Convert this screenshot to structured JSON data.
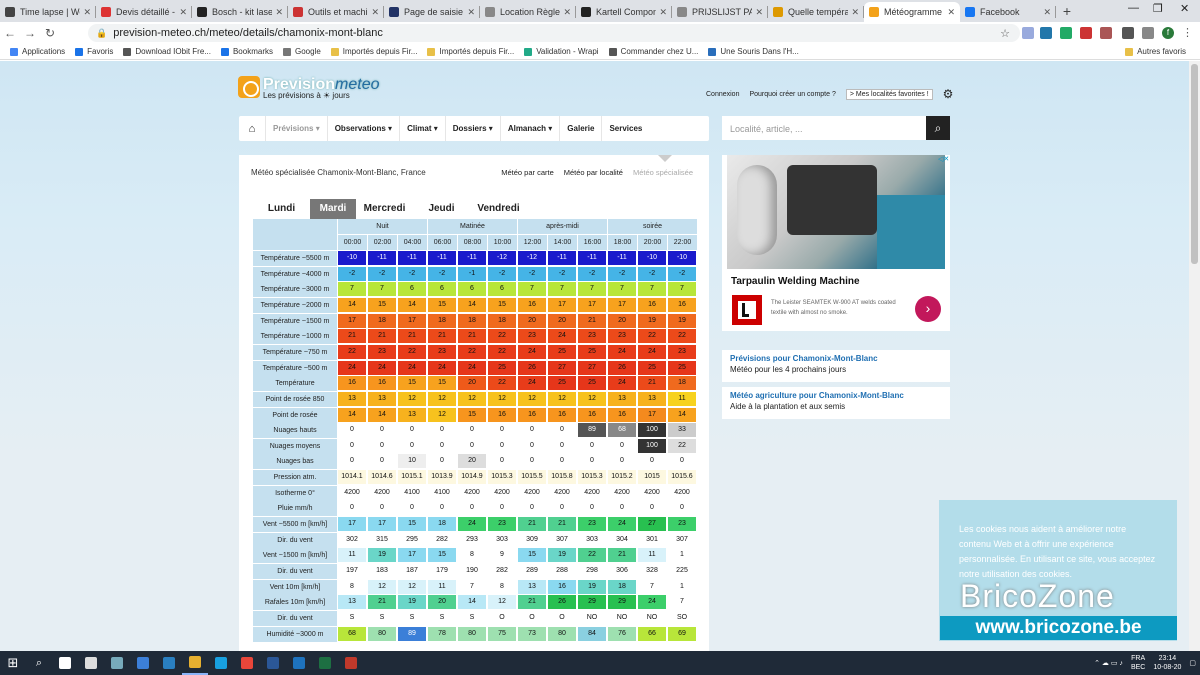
{
  "browser": {
    "tabs": [
      {
        "title": "Time lapse | Wei",
        "color": "#444"
      },
      {
        "title": "Devis détaillé - E",
        "color": "#d33"
      },
      {
        "title": "Bosch - kit laser",
        "color": "#222"
      },
      {
        "title": "Outils et machin",
        "color": "#c33"
      },
      {
        "title": "Page de saisie de",
        "color": "#236"
      },
      {
        "title": "Location Règle à",
        "color": "#888"
      },
      {
        "title": "Kartell Compone",
        "color": "#222"
      },
      {
        "title": "PRIJSLIJST PARTI",
        "color": "#888"
      },
      {
        "title": "Quelle températu",
        "color": "#d90"
      },
      {
        "title": "Météogramme d",
        "color": "#f3a21a"
      },
      {
        "title": "Facebook",
        "color": "#1877f2"
      }
    ],
    "url": "prevision-meteo.ch/meteo/details/chamonix-mont-blanc",
    "bookmarks": [
      {
        "label": "Applications",
        "color": "#4285f4"
      },
      {
        "label": "Favoris",
        "color": "#1a73e8"
      },
      {
        "label": "Download IObit Fre...",
        "color": "#555"
      },
      {
        "label": "Bookmarks",
        "color": "#1a73e8"
      },
      {
        "label": "Google",
        "color": "#777"
      },
      {
        "label": "Importés depuis Fir...",
        "color": "#e8c048"
      },
      {
        "label": "Importés depuis Fir...",
        "color": "#e8c048"
      },
      {
        "label": "Validation - Wrapi",
        "color": "#2a8"
      },
      {
        "label": "Commander chez U...",
        "color": "#555"
      },
      {
        "label": "Une Souris Dans l'H...",
        "color": "#2a6ebb"
      }
    ],
    "other_bookmarks": "Autres favoris",
    "profile": "f"
  },
  "site": {
    "logo_text": "Prevision",
    "logo_meteo": "meteo",
    "tagline": "Les prévisions à ☀ jours",
    "connexion": "Connexion",
    "create": "Pourquoi créer un compte ?",
    "fav": "> Mes localités favorites !",
    "nav": [
      "Prévisions ▾",
      "Observations ▾",
      "Climat ▾",
      "Dossiers ▾",
      "Almanach ▾",
      "Galerie",
      "Services"
    ],
    "search_placeholder": "Localité, article, ..."
  },
  "main": {
    "title": "Météo spécialisée Chamonix-Mont-Blanc, France",
    "tabs": [
      "Météo par carte",
      "Météo par localité",
      "Météo spécialisée"
    ],
    "days": [
      "Lundi",
      "Mardi",
      "Mercredi",
      "Jeudi",
      "Vendredi"
    ],
    "periods": [
      "Nuit",
      "Matinée",
      "après-midi",
      "soirée"
    ],
    "hours": [
      "00:00",
      "02:00",
      "04:00",
      "06:00",
      "08:00",
      "10:00",
      "12:00",
      "14:00",
      "16:00",
      "18:00",
      "20:00",
      "22:00"
    ],
    "rows": [
      {
        "label": "Température ~5500 m",
        "values": [
          "-10",
          "-11",
          "-11",
          "-11",
          "-11",
          "-12",
          "-12",
          "-11",
          "-11",
          "-11",
          "-10",
          "-10"
        ],
        "colors": [
          "#1a1acc",
          "#1a1acc",
          "#1a1acc",
          "#1a1acc",
          "#1a1acc",
          "#1a1acc",
          "#1a1acc",
          "#1a1acc",
          "#1a1acc",
          "#1a1acc",
          "#1a1acc",
          "#1a1acc"
        ]
      },
      {
        "label": "Température ~4000 m",
        "values": [
          "-2",
          "-2",
          "-2",
          "-2",
          "-1",
          "-2",
          "-2",
          "-2",
          "-2",
          "-2",
          "-2",
          "-2"
        ],
        "colors": [
          "#45b4e6",
          "#45b4e6",
          "#45b4e6",
          "#45b4e6",
          "#45b4e6",
          "#45b4e6",
          "#45b4e6",
          "#45b4e6",
          "#45b4e6",
          "#45b4e6",
          "#45b4e6",
          "#45b4e6"
        ]
      },
      {
        "label": "Température ~3000 m",
        "values": [
          "7",
          "7",
          "6",
          "6",
          "6",
          "6",
          "7",
          "7",
          "7",
          "7",
          "7",
          "7"
        ],
        "colors": [
          "#b8e63a",
          "#b8e63a",
          "#b8e63a",
          "#b8e63a",
          "#b8e63a",
          "#b8e63a",
          "#b8e63a",
          "#b8e63a",
          "#b8e63a",
          "#b8e63a",
          "#b8e63a",
          "#b8e63a"
        ]
      },
      {
        "label": "Température ~2000 m",
        "values": [
          "14",
          "15",
          "14",
          "15",
          "14",
          "15",
          "16",
          "17",
          "17",
          "17",
          "16",
          "16"
        ],
        "colors": [
          "#f7a21e",
          "#f7a21e",
          "#f7a21e",
          "#f7a21e",
          "#f7a21e",
          "#f7a21e",
          "#f7a21e",
          "#f7a21e",
          "#f7a21e",
          "#f7a21e",
          "#f7a21e",
          "#f7a21e"
        ]
      },
      {
        "label": "Température ~1500 m",
        "values": [
          "17",
          "18",
          "17",
          "18",
          "18",
          "18",
          "20",
          "20",
          "21",
          "20",
          "19",
          "19"
        ],
        "colors": [
          "#f06a1e",
          "#f06a1e",
          "#f06a1e",
          "#f06a1e",
          "#f06a1e",
          "#f06a1e",
          "#f06a1e",
          "#f06a1e",
          "#f06a1e",
          "#f06a1e",
          "#f06a1e",
          "#f06a1e"
        ]
      },
      {
        "label": "Température ~1000 m",
        "values": [
          "21",
          "21",
          "21",
          "21",
          "21",
          "22",
          "23",
          "24",
          "23",
          "23",
          "22",
          "22"
        ],
        "colors": [
          "#ec4a1a",
          "#ec4a1a",
          "#ec4a1a",
          "#ec4a1a",
          "#ec4a1a",
          "#ec4a1a",
          "#ec4a1a",
          "#ec4a1a",
          "#ec4a1a",
          "#ec4a1a",
          "#ec4a1a",
          "#ec4a1a"
        ]
      },
      {
        "label": "Température ~750 m",
        "values": [
          "22",
          "23",
          "22",
          "23",
          "22",
          "22",
          "24",
          "25",
          "25",
          "24",
          "24",
          "23"
        ],
        "colors": [
          "#e83c1a",
          "#e83c1a",
          "#e83c1a",
          "#e83c1a",
          "#e83c1a",
          "#e83c1a",
          "#e83c1a",
          "#e83c1a",
          "#e83c1a",
          "#e83c1a",
          "#e83c1a",
          "#e83c1a"
        ]
      },
      {
        "label": "Température ~500 m",
        "values": [
          "24",
          "24",
          "24",
          "24",
          "24",
          "25",
          "26",
          "27",
          "27",
          "26",
          "25",
          "25"
        ],
        "colors": [
          "#e6361a",
          "#e6361a",
          "#e6361a",
          "#e6361a",
          "#e6361a",
          "#e6361a",
          "#e6361a",
          "#e6361a",
          "#e6361a",
          "#e6361a",
          "#e6361a",
          "#e6361a"
        ]
      },
      {
        "label": "Température",
        "values": [
          "16",
          "16",
          "15",
          "15",
          "20",
          "22",
          "24",
          "25",
          "25",
          "24",
          "21",
          "18"
        ],
        "colors": [
          "#f7951e",
          "#f7951e",
          "#f7a21e",
          "#f7a21e",
          "#ef5a1a",
          "#ec4a1a",
          "#e83c1a",
          "#e6361a",
          "#e6361a",
          "#e83c1a",
          "#ec4a1a",
          "#f06a1e"
        ]
      },
      {
        "label": "Point de rosée 850",
        "values": [
          "13",
          "13",
          "12",
          "12",
          "12",
          "12",
          "12",
          "12",
          "12",
          "13",
          "13",
          "11"
        ],
        "colors": [
          "#f7b21e",
          "#f7b21e",
          "#f7c21e",
          "#f7c21e",
          "#f7c21e",
          "#f7c21e",
          "#f7c21e",
          "#f7c21e",
          "#f7c21e",
          "#f7b21e",
          "#f7b21e",
          "#f7d21e"
        ]
      },
      {
        "label": "Point de rosée",
        "values": [
          "14",
          "14",
          "13",
          "12",
          "15",
          "16",
          "16",
          "16",
          "16",
          "16",
          "17",
          "14"
        ],
        "colors": [
          "#f7a21e",
          "#f7a21e",
          "#f7b21e",
          "#f7c21e",
          "#f7951e",
          "#f7951e",
          "#f7951e",
          "#f7951e",
          "#f7951e",
          "#f7951e",
          "#f48a1e",
          "#f7a21e"
        ]
      },
      {
        "label": "Nuages hauts",
        "values": [
          "0",
          "0",
          "0",
          "0",
          "0",
          "0",
          "0",
          "0",
          "89",
          "68",
          "100",
          "33"
        ],
        "colors": [
          "#fff",
          "#fff",
          "#fff",
          "#fff",
          "#fff",
          "#fff",
          "#fff",
          "#fff",
          "#555",
          "#888",
          "#333",
          "#ccc"
        ]
      },
      {
        "label": "Nuages moyens",
        "values": [
          "0",
          "0",
          "0",
          "0",
          "0",
          "0",
          "0",
          "0",
          "0",
          "0",
          "100",
          "22"
        ],
        "colors": [
          "#fff",
          "#fff",
          "#fff",
          "#fff",
          "#fff",
          "#fff",
          "#fff",
          "#fff",
          "#fff",
          "#fff",
          "#333",
          "#ddd"
        ]
      },
      {
        "label": "Nuages bas",
        "values": [
          "0",
          "0",
          "10",
          "0",
          "20",
          "0",
          "0",
          "0",
          "0",
          "0",
          "0",
          "0"
        ],
        "colors": [
          "#fff",
          "#fff",
          "#eee",
          "#fff",
          "#ddd",
          "#fff",
          "#fff",
          "#fff",
          "#fff",
          "#fff",
          "#fff",
          "#fff"
        ]
      },
      {
        "label": "Pression atm.",
        "values": [
          "1014.1",
          "1014.6",
          "1015.1",
          "1013.9",
          "1014.9",
          "1015.3",
          "1015.5",
          "1015.8",
          "1015.3",
          "1015.2",
          "1015",
          "1015.6"
        ],
        "colors": [
          "#fdf8e0",
          "#fdf8e0",
          "#fdf8e0",
          "#fdf8e0",
          "#fdf8e0",
          "#fdf8e0",
          "#fdf8e0",
          "#fdf8e0",
          "#fdf8e0",
          "#fdf8e0",
          "#fdf8e0",
          "#fdf8e0"
        ]
      },
      {
        "label": "Isotherme 0°",
        "values": [
          "4200",
          "4200",
          "4100",
          "4100",
          "4200",
          "4200",
          "4200",
          "4200",
          "4200",
          "4200",
          "4200",
          "4200"
        ],
        "colors": [
          "#fff",
          "#fff",
          "#fff",
          "#fff",
          "#fff",
          "#fff",
          "#fff",
          "#fff",
          "#fff",
          "#fff",
          "#fff",
          "#fff"
        ]
      },
      {
        "label": "Pluie mm/h",
        "values": [
          "0",
          "0",
          "0",
          "0",
          "0",
          "0",
          "0",
          "0",
          "0",
          "0",
          "0",
          "0"
        ],
        "colors": [
          "#fff",
          "#fff",
          "#fff",
          "#fff",
          "#fff",
          "#fff",
          "#fff",
          "#fff",
          "#fff",
          "#fff",
          "#fff",
          "#fff"
        ]
      },
      {
        "label": "Vent ~5500 m [km/h]",
        "values": [
          "17",
          "17",
          "15",
          "18",
          "24",
          "23",
          "21",
          "21",
          "23",
          "24",
          "27",
          "23"
        ],
        "colors": [
          "#8ad9f0",
          "#8ad9f0",
          "#8ad9f0",
          "#8ad9f0",
          "#3ccf6a",
          "#3ccf6a",
          "#50d090",
          "#50d090",
          "#3ccf6a",
          "#3ccf6a",
          "#28c050",
          "#3ccf6a"
        ]
      },
      {
        "label": "Dir. du vent",
        "values": [
          "302",
          "315",
          "295",
          "282",
          "293",
          "303",
          "309",
          "307",
          "303",
          "304",
          "301",
          "307"
        ],
        "colors": [
          "#fff",
          "#fff",
          "#fff",
          "#fff",
          "#fff",
          "#fff",
          "#fff",
          "#fff",
          "#fff",
          "#fff",
          "#fff",
          "#fff"
        ]
      },
      {
        "label": "Vent ~1500 m [km/h]",
        "values": [
          "11",
          "19",
          "17",
          "15",
          "8",
          "9",
          "15",
          "19",
          "22",
          "21",
          "11",
          "1"
        ],
        "colors": [
          "#d8f2fa",
          "#6ad6c8",
          "#8ad9f0",
          "#8ad9f0",
          "#fff",
          "#fff",
          "#8ad9f0",
          "#6ad6c8",
          "#50d090",
          "#50d090",
          "#d8f2fa",
          "#fff"
        ]
      },
      {
        "label": "Dir. du vent",
        "values": [
          "197",
          "183",
          "187",
          "179",
          "190",
          "282",
          "289",
          "288",
          "298",
          "306",
          "328",
          "225"
        ],
        "colors": [
          "#fff",
          "#fff",
          "#fff",
          "#fff",
          "#fff",
          "#fff",
          "#fff",
          "#fff",
          "#fff",
          "#fff",
          "#fff",
          "#fff"
        ]
      },
      {
        "label": "Vent 10m [km/h]",
        "values": [
          "8",
          "12",
          "12",
          "11",
          "7",
          "8",
          "13",
          "16",
          "19",
          "18",
          "7",
          "1"
        ],
        "colors": [
          "#fff",
          "#d8f2fa",
          "#d8f2fa",
          "#d8f2fa",
          "#fff",
          "#fff",
          "#b8e8f6",
          "#8ad9f0",
          "#6ad6c8",
          "#6ad6c8",
          "#fff",
          "#fff"
        ]
      },
      {
        "label": "Rafales 10m [km/h]",
        "values": [
          "13",
          "21",
          "19",
          "20",
          "14",
          "12",
          "21",
          "26",
          "29",
          "29",
          "24",
          "7"
        ],
        "colors": [
          "#b8e8f6",
          "#50d090",
          "#6ad6c8",
          "#50d090",
          "#b8e8f6",
          "#d8f2fa",
          "#50d090",
          "#28c050",
          "#28c050",
          "#28c050",
          "#3ccf6a",
          "#fff"
        ]
      },
      {
        "label": "Dir. du vent",
        "values": [
          "S",
          "S",
          "S",
          "S",
          "S",
          "O",
          "O",
          "O",
          "NO",
          "NO",
          "NO",
          "SO"
        ],
        "colors": [
          "#fff",
          "#fff",
          "#fff",
          "#fff",
          "#fff",
          "#fff",
          "#fff",
          "#fff",
          "#fff",
          "#fff",
          "#fff",
          "#fff"
        ]
      },
      {
        "label": "Humidité ~3000 m",
        "values": [
          "68",
          "80",
          "89",
          "78",
          "80",
          "75",
          "73",
          "80",
          "84",
          "76",
          "66",
          "69"
        ],
        "colors": [
          "#b8e63a",
          "#9ee0b0",
          "#3b7fd8",
          "#9ee0b0",
          "#9ee0b0",
          "#9ee0b0",
          "#9ee0b0",
          "#9ee0b0",
          "#8ad0e0",
          "#9ee0b0",
          "#b8e63a",
          "#b8e63a"
        ]
      }
    ]
  },
  "sidebar": {
    "ad_title": "Tarpaulin Welding Machine",
    "ad_text": "The Leister SEAMTEK W-900 AT welds coated textile with almost no smoke.",
    "links": [
      {
        "title": "Prévisions pour Chamonix-Mont-Blanc",
        "sub": "Météo pour les 4 prochains jours"
      },
      {
        "title": "Météo agriculture pour Chamonix-Mont-Blanc",
        "sub": "Aide à la plantation et aux semis"
      }
    ]
  },
  "cookie": {
    "text": "Les cookies nous aident à améliorer notre contenu Web et à offrir une expérience personnalisée. En utilisant ce site, vous acceptez notre utilisation des cookies.",
    "brand": "BricoZone",
    "brand_url": "www.bricozone.be"
  },
  "taskbar": {
    "lang": "FRA",
    "layout": "BEC",
    "time": "23:14",
    "date": "10-08-20",
    "apps": [
      "#fff",
      "#ddd",
      "#7ab",
      "#3c7fd8",
      "#2a7fc0",
      "#e6b030",
      "#18a0e0",
      "#e8463a",
      "#2b5797",
      "#1e73be",
      "#1d6f42",
      "#c0392b"
    ]
  }
}
